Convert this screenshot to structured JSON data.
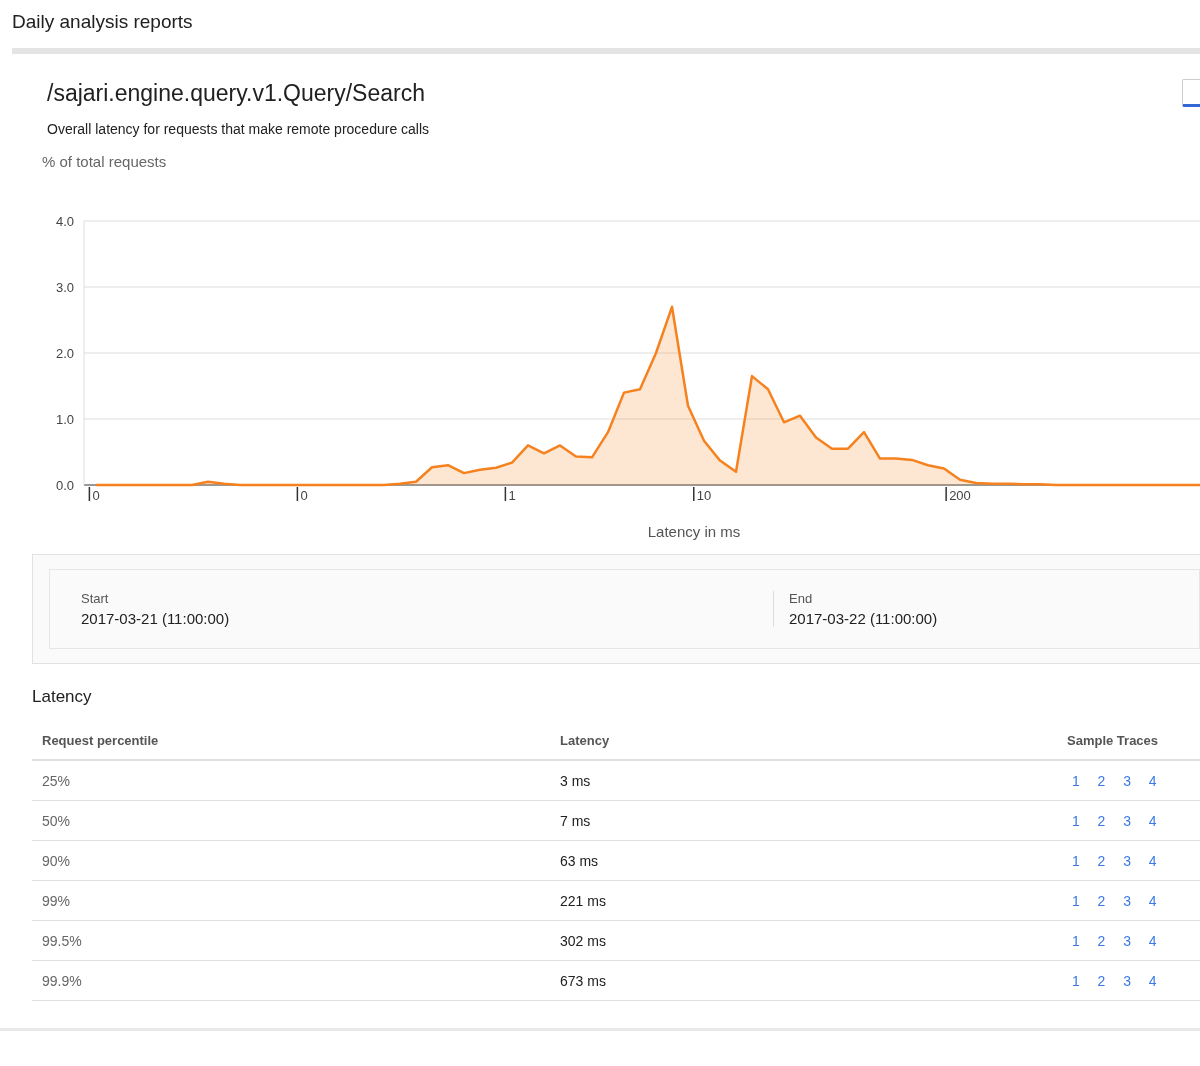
{
  "header": {
    "title": "Daily analysis reports"
  },
  "report": {
    "title": "/sajari.engine.query.v1.Query/Search",
    "subtitle": "Overall latency for requests that make remote procedure calls",
    "chart_data": {
      "type": "area",
      "ylabel": "% of total requests",
      "xlabel": "Latency in ms",
      "categories": [
        "0",
        null,
        null,
        null,
        null,
        null,
        null,
        null,
        null,
        null,
        null,
        null,
        null,
        "0",
        null,
        null,
        null,
        null,
        null,
        null,
        null,
        null,
        null,
        null,
        null,
        null,
        "1",
        null,
        null,
        null,
        null,
        null,
        null,
        null,
        null,
        null,
        null,
        null,
        "10",
        null,
        null,
        null,
        null,
        null,
        null,
        null,
        null,
        null,
        null,
        null,
        null,
        null,
        null,
        null,
        "200",
        null,
        null,
        null,
        null,
        null,
        null,
        null,
        null,
        null,
        null,
        null,
        null,
        null,
        null,
        null
      ],
      "series": [
        {
          "color": "#f5821f",
          "values": [
            0,
            0,
            0,
            0,
            0,
            0,
            0,
            0.05,
            0.02,
            0,
            0,
            0,
            0,
            0,
            0,
            0,
            0,
            0,
            0,
            0.02,
            0.05,
            0.27,
            0.3,
            0.18,
            0.23,
            0.26,
            0.34,
            0.6,
            0.48,
            0.6,
            0.43,
            0.42,
            0.8,
            1.4,
            1.45,
            2.0,
            2.7,
            1.2,
            0.67,
            0.37,
            0.2,
            1.65,
            1.45,
            0.95,
            1.05,
            0.72,
            0.55,
            0.55,
            0.8,
            0.4,
            0.4,
            0.38,
            0.3,
            0.25,
            0.08,
            0.03,
            0.02,
            0.02,
            0.01,
            0.01,
            0,
            0,
            0,
            0,
            0,
            0,
            0,
            0,
            0,
            0
          ]
        }
      ],
      "grid": true,
      "ylim": [
        0,
        4
      ],
      "yticks": [
        {
          "value": 0,
          "label": "0.0"
        },
        {
          "value": 1,
          "label": "1.0"
        },
        {
          "value": 2,
          "label": "2.0"
        },
        {
          "value": 3,
          "label": "3.0"
        },
        {
          "value": 4,
          "label": "4.0"
        }
      ]
    }
  },
  "time_range": [
    {
      "label": "Start",
      "value": "2017-03-21 (11:00:00)"
    },
    {
      "label": "End",
      "value": "2017-03-22 (11:00:00)"
    }
  ],
  "latency": {
    "title": "Latency",
    "columns": [
      "Request percentile",
      "Latency",
      "Sample Traces"
    ],
    "rows": [
      {
        "percentile": "25%",
        "latency": "3 ms",
        "traces": [
          "1",
          "2",
          "3",
          "4"
        ]
      },
      {
        "percentile": "50%",
        "latency": "7 ms",
        "traces": [
          "1",
          "2",
          "3",
          "4"
        ]
      },
      {
        "percentile": "90%",
        "latency": "63 ms",
        "traces": [
          "1",
          "2",
          "3",
          "4"
        ]
      },
      {
        "percentile": "99%",
        "latency": "221 ms",
        "traces": [
          "1",
          "2",
          "3",
          "4"
        ]
      },
      {
        "percentile": "99.5%",
        "latency": "302 ms",
        "traces": [
          "1",
          "2",
          "3",
          "4"
        ]
      },
      {
        "percentile": "99.9%",
        "latency": "673 ms",
        "traces": [
          "1",
          "2",
          "3",
          "4"
        ]
      }
    ]
  }
}
